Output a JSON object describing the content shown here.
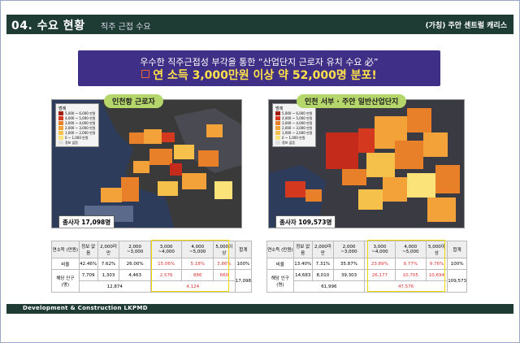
{
  "header": {
    "title": "04. 수요 현황",
    "subtitle": "직주 근접 수요",
    "project": "(가칭) 주안 센트럴 캐리스"
  },
  "banner": {
    "line1": "우수한 직주근접성 부각을 통한 “산업단지 근로자 유치 수요 必”",
    "line2": "연 소득 3,000만원 이상 약 52,000명 분포!"
  },
  "left": {
    "map_label": "인천항 근로자",
    "workers": "종사자 17,098명",
    "table": {
      "headers": [
        "연소득 (만원)",
        "정보 없음",
        "2,000미만",
        "2,000 ~3,000",
        "3,000 ~4,000",
        "4,000 ~5,000",
        "5,000이상",
        "합계"
      ],
      "ratio": [
        "비율",
        "42.46%",
        "7.62%",
        "26.00%",
        "15.06%",
        "5.18%",
        "3.86%",
        "100%"
      ],
      "pop": [
        "해당 인구 (명)",
        "7,709",
        "1,303",
        "4,463",
        "2,576",
        "886",
        "660",
        "17,098"
      ],
      "sum_left": "12,874",
      "sum_right": "4,124"
    }
  },
  "right": {
    "map_label": "인천 서부 · 주안 일반산업단지",
    "workers": "종사자 109,573명",
    "table": {
      "headers": [
        "연소득 (만원)",
        "정보 없음",
        "2,000미만",
        "2,000 ~3,000",
        "3,000 ~4,000",
        "4,000 ~5,000",
        "5,000이상",
        "합계"
      ],
      "ratio": [
        "비율",
        "13.40%",
        "7.31%",
        "35.87%",
        "23.89%",
        "9.77%",
        "9.76%",
        "100%"
      ],
      "pop": [
        "해당 인구 (명)",
        "14,683",
        "8,010",
        "39,303",
        "26,177",
        "10,705",
        "10,694",
        "109,573"
      ],
      "sum_left": "61,996",
      "sum_right": "47,576"
    }
  },
  "legend": {
    "title": "범례",
    "items": [
      "5,000 ~ 6,000 만원",
      "4,000 ~ 5,000 만원",
      "3,000 ~ 4,000 만원",
      "2,000 ~ 3,000 만원",
      "1,000 ~ 2,000 만원",
      "0 ~ 1,000 만원",
      "정보 없음"
    ]
  },
  "colors": {
    "dark": "#1e3b34",
    "banner": "#3f2f86",
    "accent": "#ffe24a",
    "label": "#b4d66a",
    "highlight": "#f0d800"
  },
  "footer": {
    "text": "Development & Construction LKPMD"
  }
}
